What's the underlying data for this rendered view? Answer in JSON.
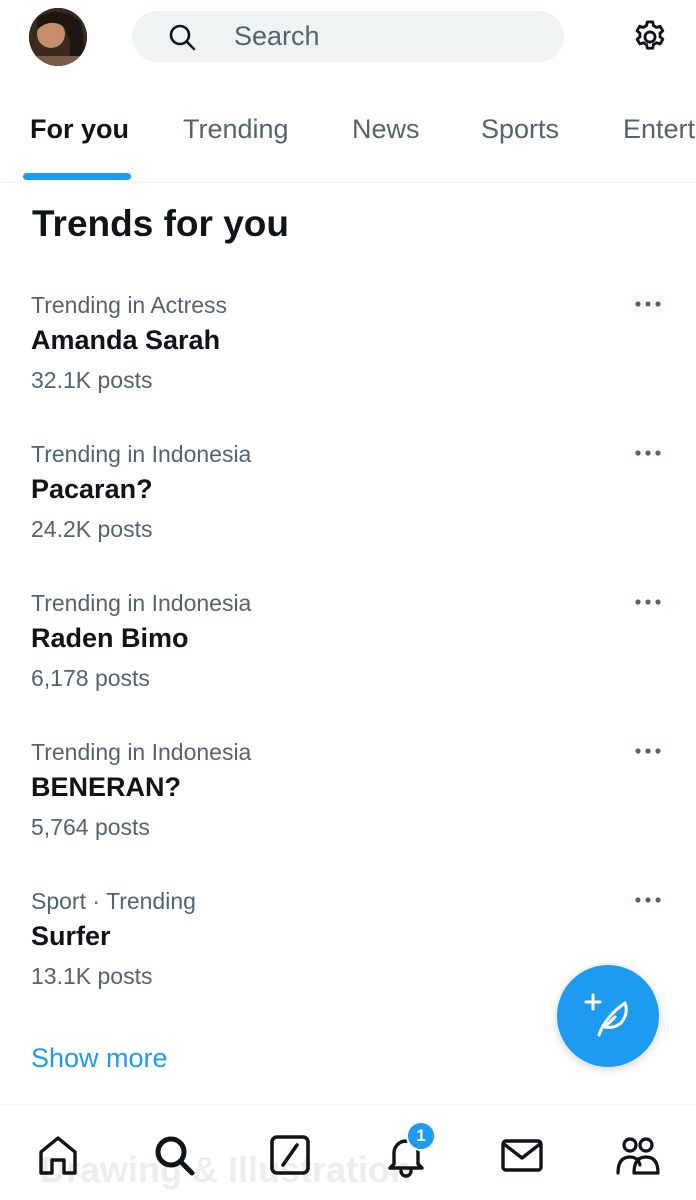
{
  "search": {
    "placeholder": "Search"
  },
  "tabs": [
    {
      "label": "For you",
      "active": true
    },
    {
      "label": "Trending",
      "active": false
    },
    {
      "label": "News",
      "active": false
    },
    {
      "label": "Sports",
      "active": false
    },
    {
      "label": "Entert",
      "active": false
    }
  ],
  "section_title": "Trends for you",
  "trends": [
    {
      "context": "Trending in Actress",
      "name": "Amanda Sarah",
      "count": "32.1K posts"
    },
    {
      "context": "Trending in Indonesia",
      "name": "Pacaran?",
      "count": "24.2K posts"
    },
    {
      "context": "Trending in Indonesia",
      "name": "Raden Bimo",
      "count": "6,178 posts"
    },
    {
      "context": "Trending in Indonesia",
      "name": "BENERAN?",
      "count": "5,764 posts"
    },
    {
      "context": "Sport · Trending",
      "name": "Surfer",
      "count": "13.1K posts"
    }
  ],
  "show_more": "Show more",
  "bottom_nav": {
    "ghost_text": "Drawing & Illustration",
    "notification_badge": "1",
    "items": [
      "home-icon",
      "search-icon",
      "grok-icon",
      "bell-icon",
      "mail-icon",
      "communities-icon"
    ]
  },
  "colors": {
    "accent": "#1d9bf0",
    "text": "#0f1419",
    "secondary": "#536471"
  }
}
